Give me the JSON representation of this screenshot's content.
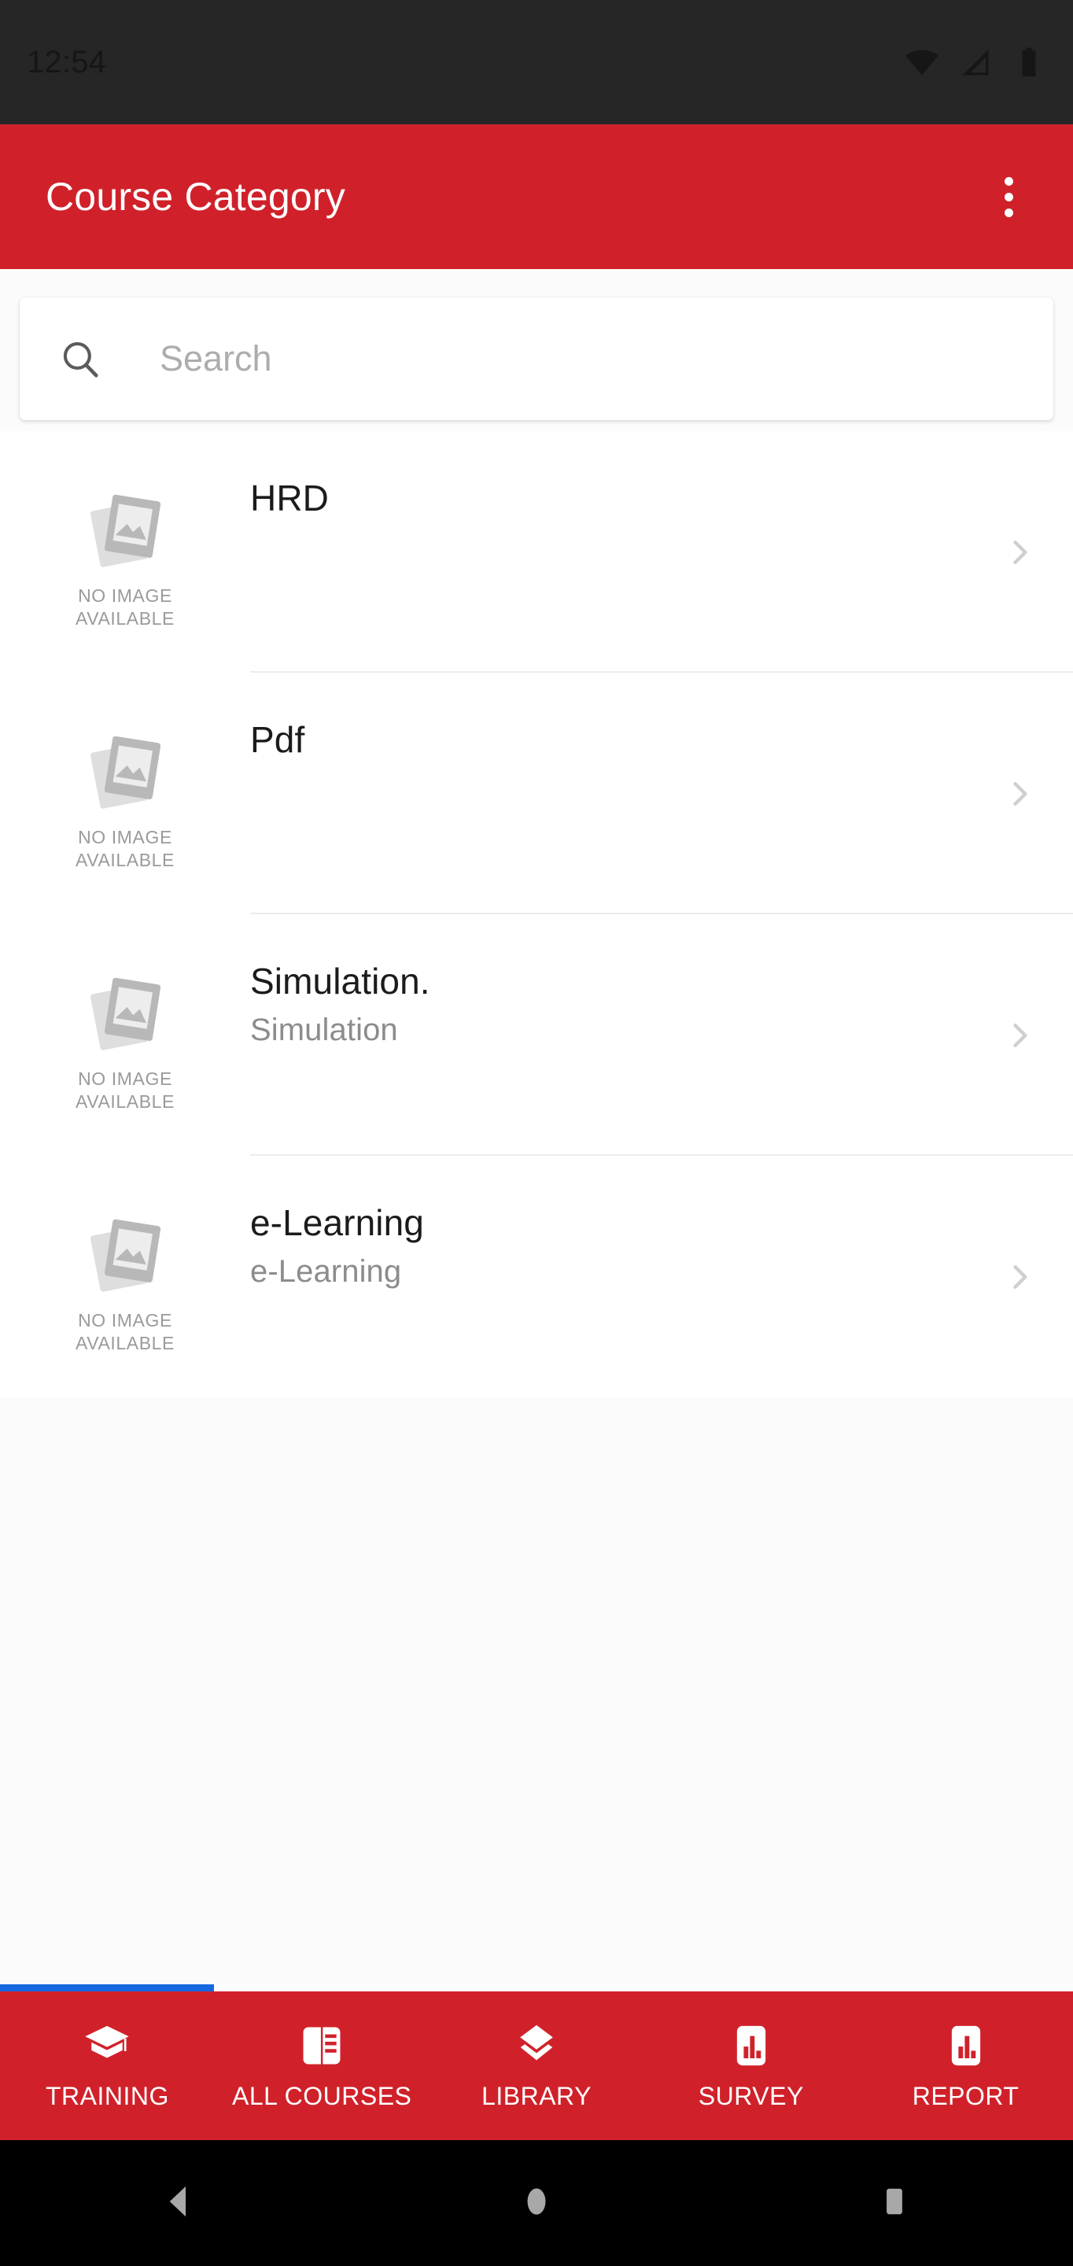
{
  "status_bar": {
    "time": "12:54",
    "icons": [
      "wifi-icon",
      "cellular-signal-icon",
      "battery-icon"
    ]
  },
  "app_bar": {
    "title": "Course Category",
    "overflow_menu": "more-options",
    "background_color": "#d0212a",
    "title_color": "#ffffff"
  },
  "search": {
    "placeholder": "Search",
    "value": "",
    "icon": "search-icon"
  },
  "list": {
    "placeholder_image_label_line1": "NO IMAGE",
    "placeholder_image_label_line2": "AVAILABLE",
    "items": [
      {
        "title": "HRD",
        "subtitle": "",
        "thumbnail": "no-image-available",
        "chevron": "chevron-right-icon"
      },
      {
        "title": "Pdf",
        "subtitle": "",
        "thumbnail": "no-image-available",
        "chevron": "chevron-right-icon"
      },
      {
        "title": "Simulation.",
        "subtitle": "Simulation",
        "thumbnail": "no-image-available",
        "chevron": "chevron-right-icon"
      },
      {
        "title": "e-Learning",
        "subtitle": "e-Learning",
        "thumbnail": "no-image-available",
        "chevron": "chevron-right-icon"
      }
    ]
  },
  "bottom_nav": {
    "active_index": 0,
    "indicator_color": "#1769e0",
    "background_color": "#d0212a",
    "items": [
      {
        "label": "TRAINING",
        "icon": "graduation-cap-icon"
      },
      {
        "label": "ALL COURSES",
        "icon": "article-document-icon"
      },
      {
        "label": "LIBRARY",
        "icon": "layers-icon"
      },
      {
        "label": "SURVEY",
        "icon": "bar-chart-icon"
      },
      {
        "label": "REPORT",
        "icon": "bar-chart-icon"
      }
    ]
  },
  "system_nav": {
    "back": "back-triangle-icon",
    "home": "home-circle-icon",
    "recents": "recents-square-icon"
  }
}
